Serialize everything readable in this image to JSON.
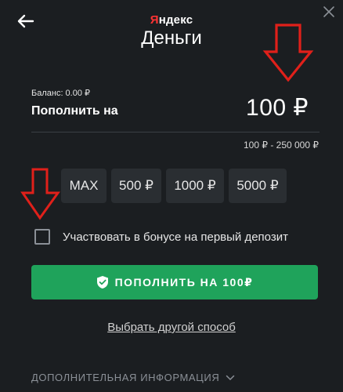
{
  "header": {
    "logo_top_red": "Я",
    "logo_top_rest": "ндекс",
    "logo_bottom": "Деньги"
  },
  "deposit": {
    "balance": "Баланс: 0.00 ₽",
    "label": "Пополнить на",
    "amount": "100 ₽",
    "range": "100 ₽ - 250 000 ₽"
  },
  "presets": [
    "MAX",
    "500 ₽",
    "1000 ₽",
    "5000 ₽"
  ],
  "bonus": {
    "checked": false,
    "label": "Участвовать в бонусе на первый депозит"
  },
  "pay_button": {
    "label": "ПОПОЛНИТЬ НА 100₽"
  },
  "other_method": "Выбрать другой способ",
  "more_info": "ДОПОЛНИТЕЛЬНАЯ ИНФОРМАЦИЯ",
  "colors": {
    "background": "#1b1e21",
    "accent_green": "#1fa35b",
    "annotation_red": "#e0201a",
    "preset_bg": "#2a2e32"
  },
  "icons": {
    "back": "arrow-left-icon",
    "close": "close-icon",
    "shield": "shield-check-icon",
    "chevron": "chevron-down-icon",
    "annotation": "red-down-arrow-icon"
  }
}
